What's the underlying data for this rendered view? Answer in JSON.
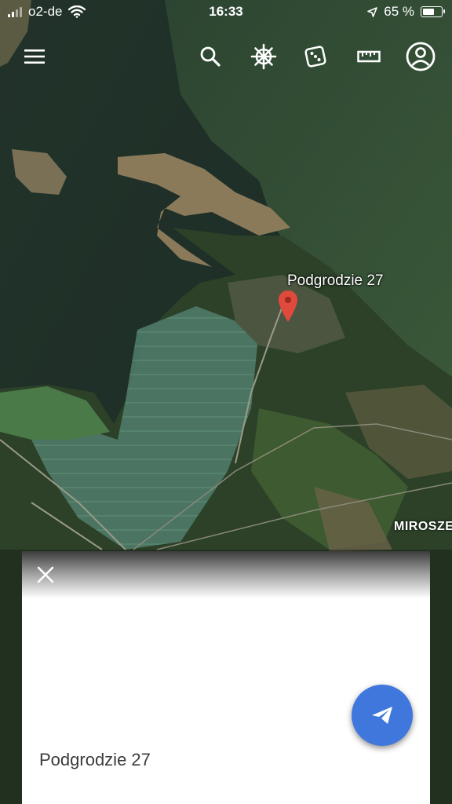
{
  "status_bar": {
    "carrier": "o2-de",
    "time": "16:33",
    "battery_percent": "65 %",
    "icons": [
      "signal-bars-icon",
      "wifi-icon",
      "location-arrow-icon",
      "battery-icon"
    ]
  },
  "toolbar": {
    "buttons": [
      "menu-icon",
      "search-icon",
      "voyager-wheel-icon",
      "random-dice-icon",
      "measure-ruler-icon",
      "account-icon"
    ]
  },
  "map": {
    "pin_label": "Podgrodzie 27",
    "town_label": "MIROSZE",
    "pin_color": "#e04a3c"
  },
  "place_card": {
    "close_icon": "close-icon",
    "title": "Podgrodzie 27",
    "share_icon": "send-icon",
    "fab_color": "#3f77dd"
  }
}
